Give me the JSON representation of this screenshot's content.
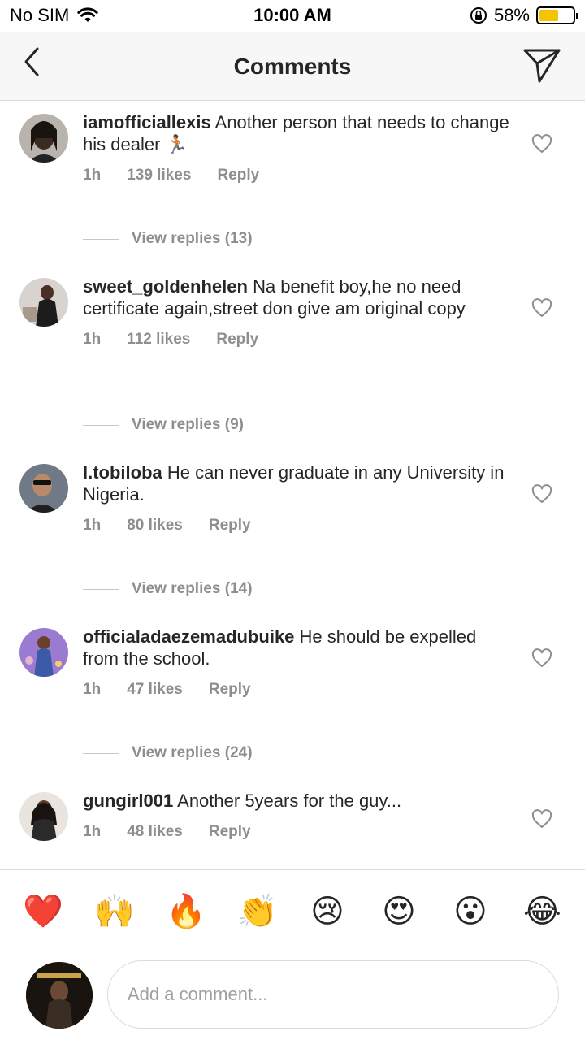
{
  "status_bar": {
    "carrier": "No SIM",
    "time": "10:00 AM",
    "battery_percent": "58%",
    "battery_level": 0.58,
    "icons": [
      "wifi-icon",
      "rotation-lock-icon",
      "battery-icon"
    ]
  },
  "header": {
    "title": "Comments",
    "back_icon": "chevron-left-icon",
    "share_icon": "send-icon"
  },
  "comments": [
    {
      "username": "iamofficiallexis",
      "text": " Another person that needs to change his dealer 🏃🏽",
      "time": "1h",
      "likes": "139 likes",
      "reply_label": "Reply",
      "view_replies": "View replies (13)"
    },
    {
      "username": "sweet_goldenhelen",
      "text": " Na benefit boy,he no need certificate again,street don give am original copy",
      "time": "1h",
      "likes": "112 likes",
      "reply_label": "Reply",
      "view_replies": "View replies (9)"
    },
    {
      "username": "l.tobiloba",
      "text": " He can never graduate in any University in Nigeria.",
      "time": "1h",
      "likes": "80 likes",
      "reply_label": "Reply",
      "view_replies": "View replies (14)"
    },
    {
      "username": "officialadaezemadubuike",
      "text": " He should be expelled from the school.",
      "time": "1h",
      "likes": "47 likes",
      "reply_label": "Reply",
      "view_replies": "View replies (24)"
    },
    {
      "username": "gungirl001",
      "text": " Another 5years for the guy...",
      "time": "1h",
      "likes": "48 likes",
      "reply_label": "Reply",
      "view_replies": ""
    }
  ],
  "emoji_bar": [
    "❤️",
    "🙌",
    "🔥",
    "👏",
    "😢",
    "😍",
    "😮",
    "😂"
  ],
  "composer": {
    "placeholder": "Add a comment..."
  },
  "colors": {
    "text": "#262626",
    "muted": "#8e8e8e",
    "divider": "#dbdbdb",
    "battery": "#f5c400"
  }
}
